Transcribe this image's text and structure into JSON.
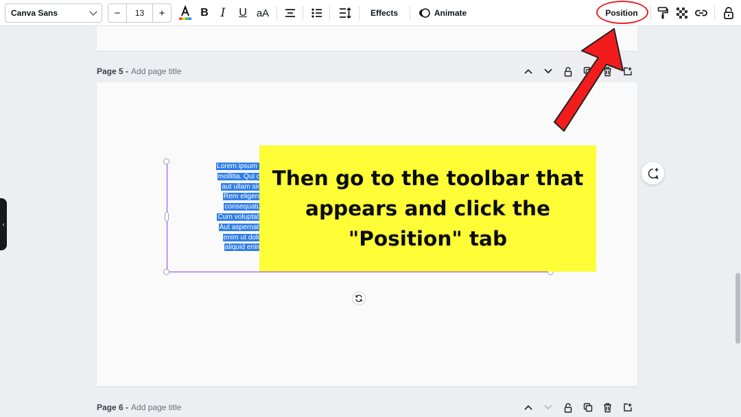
{
  "toolbar": {
    "font_family": "Canva Sans",
    "decrease_label": "−",
    "font_size": "13",
    "increase_label": "+",
    "effects_label": "Effects",
    "animate_label": "Animate",
    "position_label": "Position"
  },
  "pages": {
    "page5": {
      "number": "Page 5 -",
      "title_placeholder": "Add page title"
    },
    "page6": {
      "number": "Page 6 -",
      "title_placeholder": "Add page title"
    }
  },
  "textbox": {
    "lines": [
      "Lorem ipsum dolor sit ame",
      "mollitia. Qui cumque accu",
      "aut ullam similique ex v",
      "Rem eligendi molestia",
      "consequatur et omnis",
      "Cum voluptatibus saepe c",
      "Aut aspernatur velit est q",
      "enim ut doloremque ni",
      "aliquid enim! Et animi"
    ]
  },
  "callout": {
    "line1": "Then go to the toolbar that",
    "line2": "appears and click the",
    "line3": "\"Position\" tab"
  },
  "colors": {
    "highlight_yellow": "#fefd36",
    "annotation_red": "#e41f26",
    "selection_purple": "#8b3dff",
    "text_highlight_blue": "#2f7ee8"
  },
  "icons": [
    "chevron-down-icon",
    "text-color-icon",
    "bold-icon",
    "italic-icon",
    "underline-icon",
    "letter-case-icon",
    "align-center-icon",
    "list-icon",
    "spacing-icon",
    "animate-icon",
    "paint-roller-icon",
    "transparency-icon",
    "link-icon",
    "lock-icon",
    "chevron-up-icon",
    "trash-icon",
    "duplicate-icon",
    "add-page-icon",
    "rotate-icon",
    "comment-add-icon",
    "arrow-pointer-icon"
  ]
}
